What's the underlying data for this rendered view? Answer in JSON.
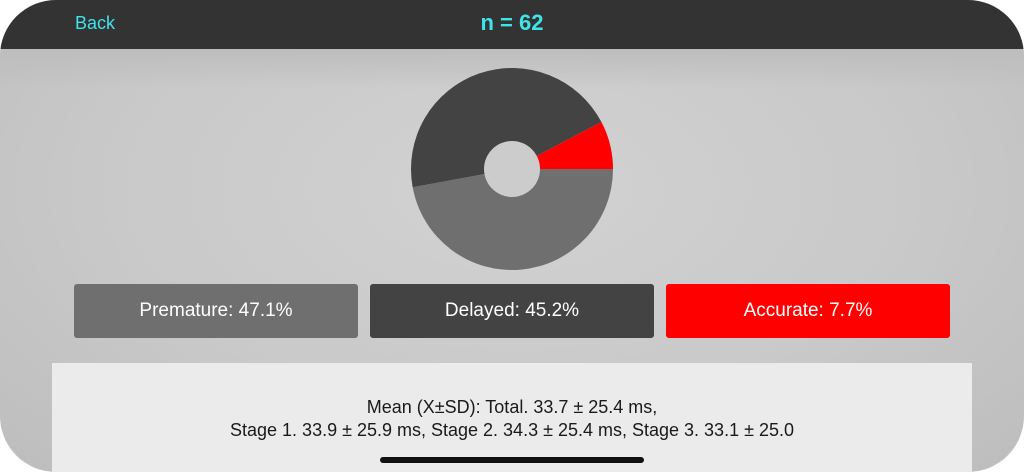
{
  "navbar": {
    "back_label": "Back",
    "title": "n = 62"
  },
  "chart_data": {
    "type": "pie",
    "donut": true,
    "categories": [
      "Premature",
      "Delayed",
      "Accurate"
    ],
    "values": [
      47.1,
      45.2,
      7.7
    ],
    "colors": [
      "#6f6f6f",
      "#434343",
      "#ff0000"
    ]
  },
  "legend": {
    "premature_label": "Premature: 47.1%",
    "delayed_label": "Delayed: 45.2%",
    "accurate_label": "Accurate: 7.7%"
  },
  "stats": {
    "line1": "Mean (X±SD): Total. 33.7 ± 25.4 ms,",
    "line2": "Stage 1. 33.9 ± 25.9 ms, Stage 2. 34.3 ± 25.4 ms, Stage 3. 33.1 ± 25.0"
  }
}
